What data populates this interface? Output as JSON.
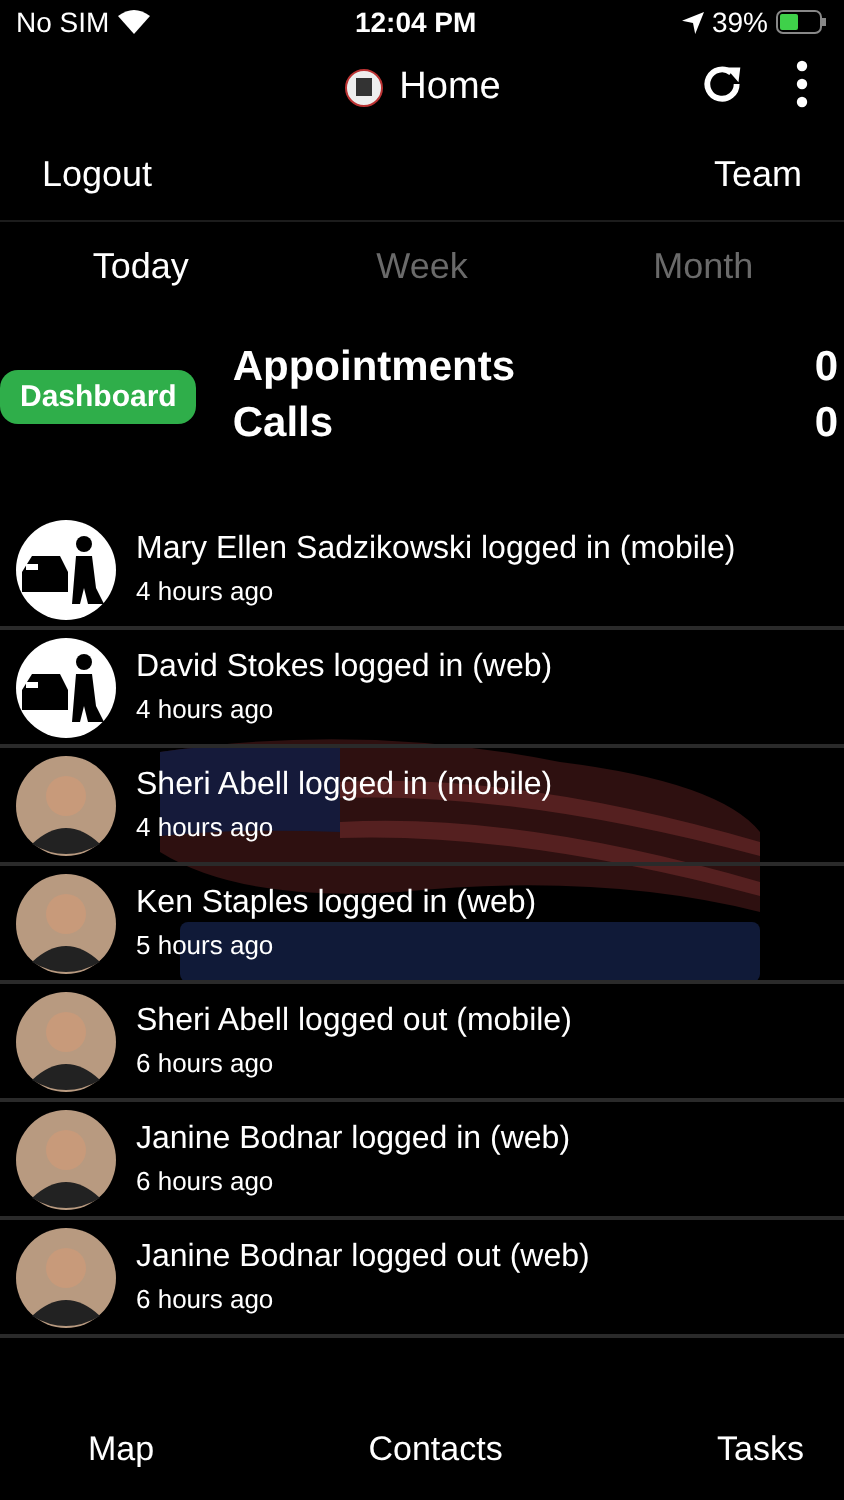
{
  "status_bar": {
    "carrier": "No SIM",
    "time": "12:04 PM",
    "battery": "39%"
  },
  "nav": {
    "title": "Home"
  },
  "top_links": [
    "Logout",
    "Team"
  ],
  "tabs": [
    {
      "label": "Today",
      "selected": true
    },
    {
      "label": "Week",
      "selected": false
    },
    {
      "label": "Month",
      "selected": false
    }
  ],
  "dashboard": {
    "button": "Dashboard",
    "stats": [
      {
        "label": "Appointments",
        "value": "0"
      },
      {
        "label": "Calls",
        "value": "0"
      }
    ]
  },
  "background": {
    "kind": "picture"
  },
  "activity": [
    {
      "text": "Mary Ellen Sadzikowski logged in (mobile)",
      "time": "4 hours ago",
      "kind": "icon"
    },
    {
      "text": "David Stokes logged in (web)",
      "time": "4 hours ago",
      "kind": "icon"
    },
    {
      "text": "Sheri Abell logged in (mobile)",
      "time": "4 hours ago"
    },
    {
      "text": "Ken Staples logged in (web)",
      "time": "5 hours ago"
    },
    {
      "text": "Sheri Abell logged out (mobile)",
      "time": "6 hours ago"
    },
    {
      "text": "Janine Bodnar logged in (web)",
      "time": "6 hours ago"
    },
    {
      "text": "Janine Bodnar logged out (web)",
      "time": "6 hours ago"
    }
  ],
  "bottom_tabs": [
    "Map",
    "Contacts",
    "Tasks"
  ]
}
